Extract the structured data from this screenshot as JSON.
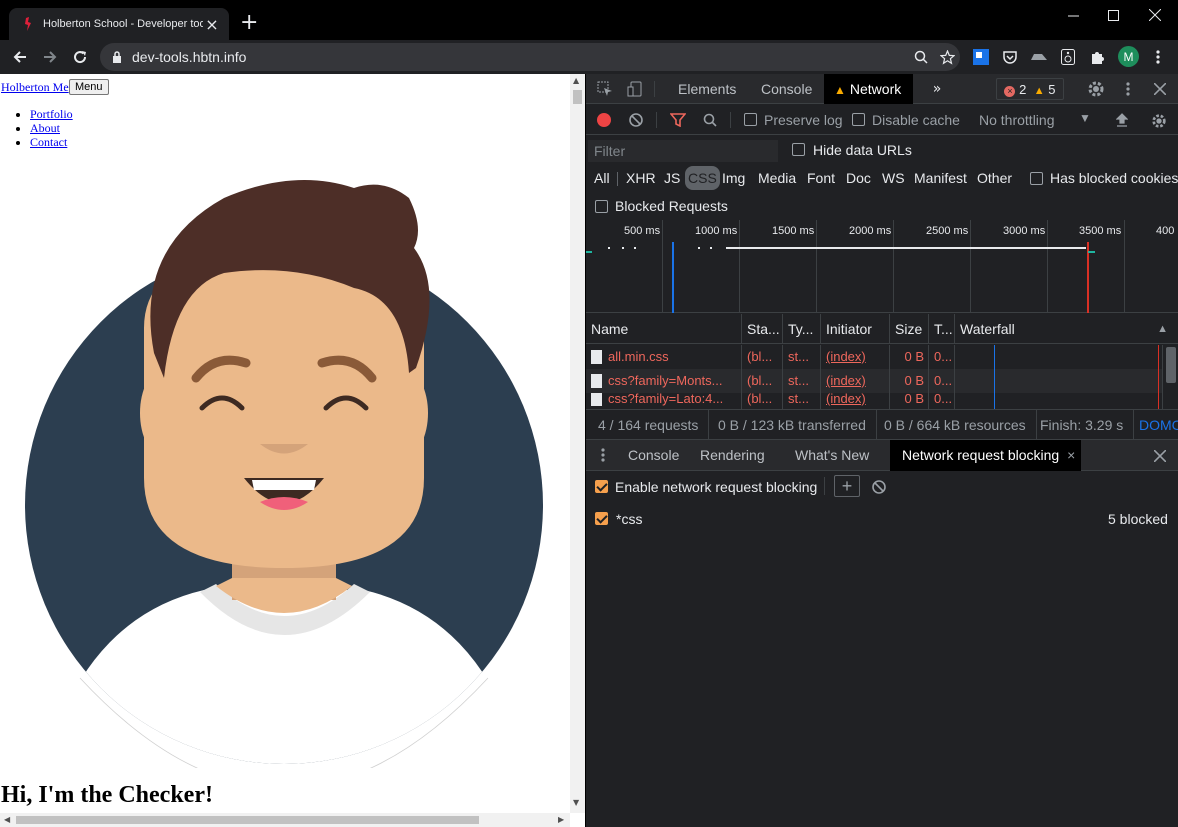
{
  "browser": {
    "tab_title": "Holberton School - Developer tools",
    "url": "dev-tools.hbtn.info",
    "profile_initial": "M"
  },
  "page": {
    "brand_link": "Holberton Me",
    "menu_button": "Menu",
    "nav_links": [
      "Portfolio",
      "About",
      "Contact"
    ],
    "heading": "Hi, I'm the Checker!"
  },
  "devtools": {
    "panel_tabs": [
      "Elements",
      "Console",
      "Network"
    ],
    "active_panel": "Network",
    "error_count": "2",
    "warning_count": "5",
    "toolbar": {
      "preserve_log": "Preserve log",
      "disable_cache": "Disable cache",
      "throttling": "No throttling"
    },
    "filter": {
      "placeholder": "Filter",
      "hide_data_urls": "Hide data URLs",
      "types": [
        "All",
        "XHR",
        "JS",
        "CSS",
        "Img",
        "Media",
        "Font",
        "Doc",
        "WS",
        "Manifest",
        "Other"
      ],
      "active_type": "CSS",
      "has_blocked_cookies": "Has blocked cookies",
      "blocked_requests": "Blocked Requests"
    },
    "timeline_ticks": [
      "500 ms",
      "1000 ms",
      "1500 ms",
      "2000 ms",
      "2500 ms",
      "3000 ms",
      "3500 ms",
      "400"
    ],
    "columns": [
      "Name",
      "Sta...",
      "Ty...",
      "Initiator",
      "Size",
      "T...",
      "Waterfall"
    ],
    "rows": [
      {
        "name": "all.min.css",
        "status": "(bl...",
        "type": "st...",
        "initiator": "(index)",
        "size": "0 B",
        "time": "0..."
      },
      {
        "name": "css?family=Monts...",
        "status": "(bl...",
        "type": "st...",
        "initiator": "(index)",
        "size": "0 B",
        "time": "0..."
      },
      {
        "name": "css?family=Lato:4...",
        "status": "(bl...",
        "type": "st...",
        "initiator": "(index)",
        "size": "0 B",
        "time": "0..."
      }
    ],
    "summary": {
      "requests": "4 / 164 requests",
      "transferred": "0 B / 123 kB transferred",
      "resources": "0 B / 664 kB resources",
      "finish": "Finish: 3.29 s",
      "domcontent": "DOMC"
    },
    "drawer": {
      "tabs": [
        "Console",
        "Rendering",
        "What's New",
        "Network request blocking"
      ],
      "active_tab": "Network request blocking",
      "enable_blocking": "Enable network request blocking",
      "pattern": "*css",
      "blocked_count": "5 blocked"
    }
  },
  "colors": {
    "accent_orange": "#f6a04d",
    "error_red": "#ee675c",
    "link_blue": "#8ab4f8",
    "avatar_bg": "#2c3e50"
  }
}
